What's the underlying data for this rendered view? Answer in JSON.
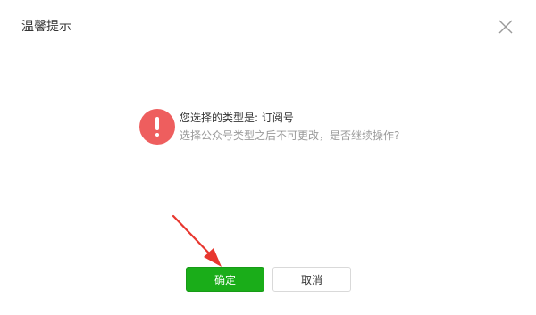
{
  "dialog": {
    "title": "温馨提示",
    "close_icon": "close-icon",
    "message": {
      "icon": "warning-icon",
      "main": "您选择的类型是: 订阅号",
      "sub": "选择公众号类型之后不可更改，是否继续操作?"
    },
    "buttons": {
      "ok": "确定",
      "cancel": "取消"
    },
    "colors": {
      "ok_button": "#1aad19",
      "warning": "#ee5e5e",
      "annotation_arrow": "#e8372f"
    }
  }
}
